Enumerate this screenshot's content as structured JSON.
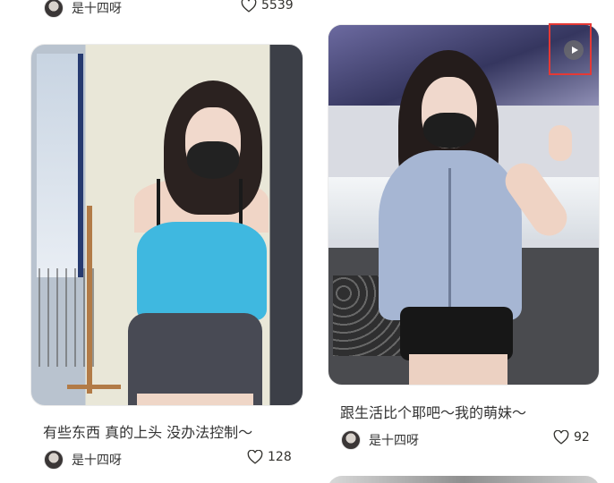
{
  "top_strip": {
    "author": "是十四呀",
    "likes": "5539"
  },
  "cards": [
    {
      "title": "有些东西 真的上头 没办法控制～",
      "author": "是十四呀",
      "likes": "128",
      "is_video": false
    },
    {
      "title": "跟生活比个耶吧～我的萌妹～",
      "author": "是十四呀",
      "likes": "92",
      "is_video": true
    }
  ],
  "icons": {
    "like": "heart-outline-icon",
    "play": "play-icon"
  },
  "colors": {
    "highlight": "#e53935",
    "text": "#333333"
  }
}
